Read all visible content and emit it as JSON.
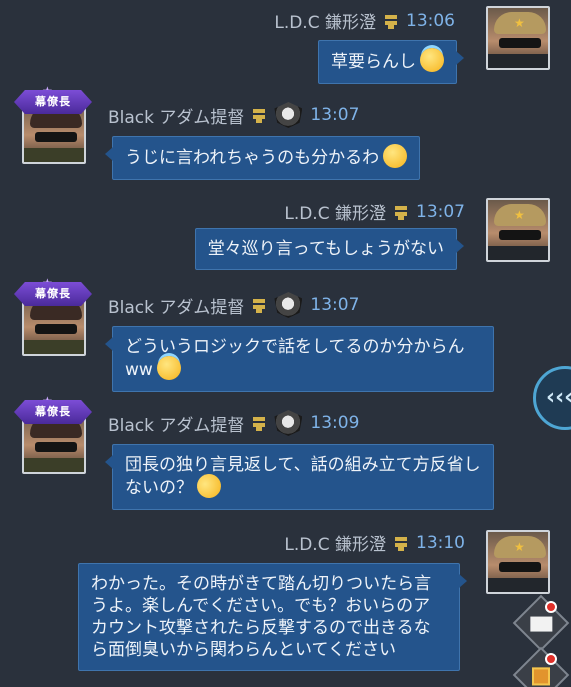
{
  "colors": {
    "background": "#2a313c",
    "bubble": "#24548c",
    "time": "#7fb3e8",
    "name": "#b9c2cf"
  },
  "messages": [
    {
      "side": "right",
      "sender": "L.D.C 鎌形澄",
      "time": "13:06",
      "text": "草要らんし",
      "emoji": "smiling-face-with-halo"
    },
    {
      "side": "left",
      "rank_badge": "幕僚長",
      "sender": "Black アダム提督",
      "time": "13:07",
      "text": "うじに言われちゃうのも分かるわ",
      "emoji": "grinning-face"
    },
    {
      "side": "right",
      "sender": "L.D.C 鎌形澄",
      "time": "13:07",
      "text": "堂々巡り言ってもしょうがない",
      "emoji": ""
    },
    {
      "side": "left",
      "rank_badge": "幕僚長",
      "sender": "Black アダム提督",
      "time": "13:07",
      "text": "どういうロジックで話をしてるのか分からんww",
      "emoji": "smiling-face-with-halo"
    },
    {
      "side": "left",
      "rank_badge": "幕僚長",
      "sender": "Black アダム提督",
      "time": "13:09",
      "text": "団長の独り言見返して、話の組み立て方反省しないの？",
      "emoji": "rolling-on-floor-laughing"
    },
    {
      "side": "right",
      "sender": "L.D.C 鎌形澄",
      "time": "13:10",
      "text": "わかった。その時がきて踏ん切りついたら言うよ。楽しんでください。でも？おいらのアカウント攻撃されたら反撃するので出きるなら面倒臭いから関わらんといてください",
      "emoji": ""
    }
  ],
  "controls": {
    "collapse_button_icon": "chevron-double-left-icon",
    "collapse_button_glyph": "‹‹‹",
    "mail_icon": "envelope-icon",
    "gift_icon": "gift-box-icon"
  }
}
